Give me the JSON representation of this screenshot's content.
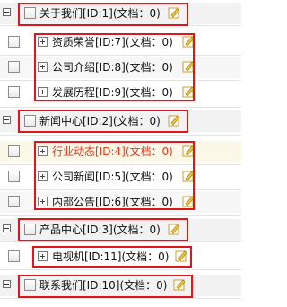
{
  "categories": [
    {
      "label": "关于我们[ID:1](文档：0)",
      "children": [
        {
          "label": "资质荣誉[ID:7](文档：0)"
        },
        {
          "label": "公司介绍[ID:8](文档：0)"
        },
        {
          "label": "发展历程[ID:9](文档：0)"
        }
      ]
    },
    {
      "label": "新闻中心[ID:2](文档：0)",
      "children": [
        {
          "label": "行业动态[ID:4](文档：0)"
        },
        {
          "label": "公司新闻[ID:5](文档：0)"
        },
        {
          "label": "内部公告[ID:6](文档：0)"
        }
      ]
    },
    {
      "label": "产品中心[ID:3](文档：0)",
      "children": [
        {
          "label": "电视机[ID:11](文档：0)"
        }
      ]
    },
    {
      "label": "联系我们[ID:10](文档：0)",
      "children": []
    }
  ],
  "icons": {
    "collapse": "minus-icon",
    "expand": "plus-icon",
    "edit": "edit-icon"
  },
  "colors": {
    "highlight_border": "#e0161b",
    "active_text": "#e23b1e"
  }
}
